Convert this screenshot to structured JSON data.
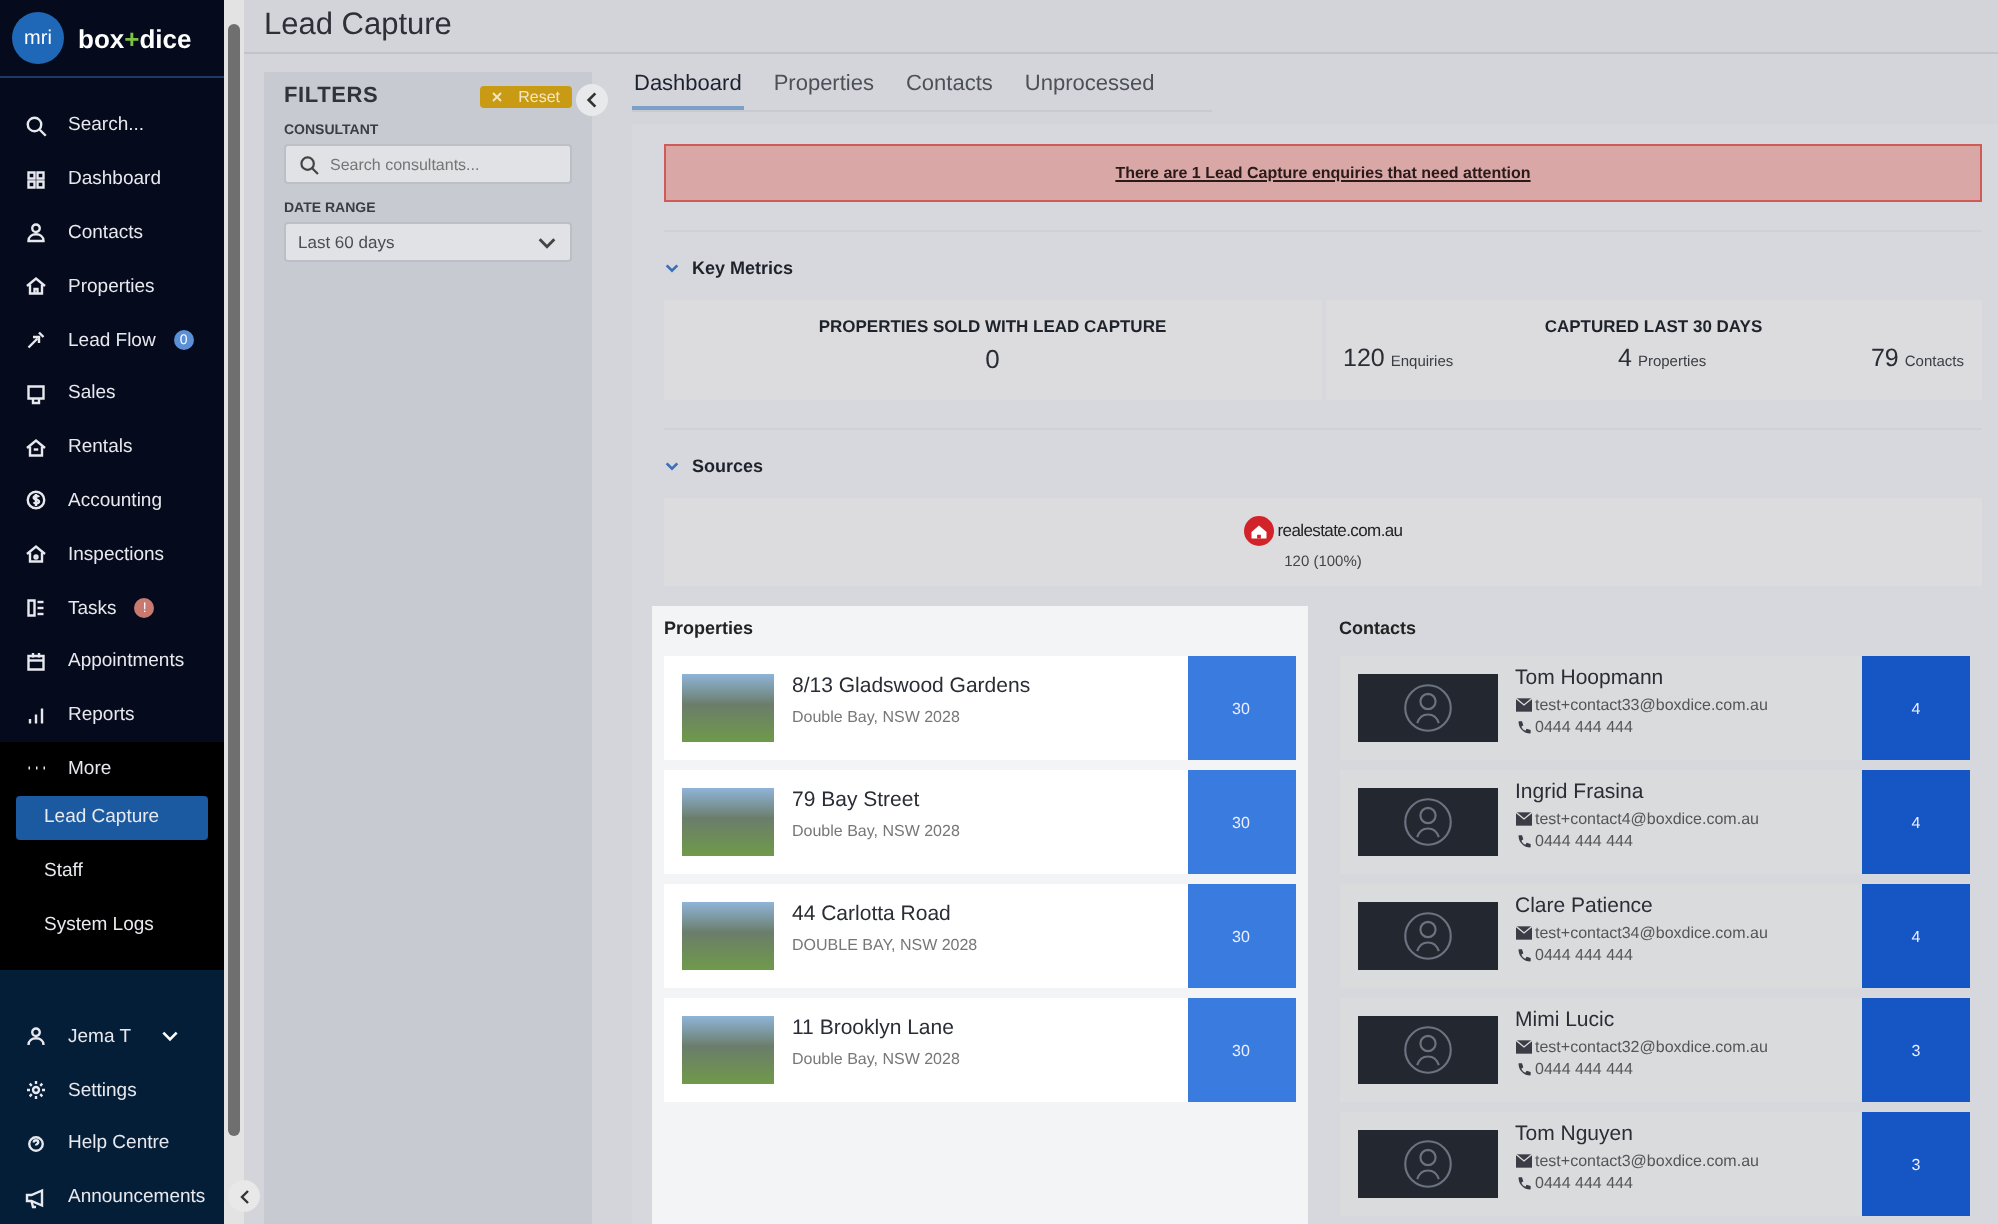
{
  "sidebar": {
    "brand": {
      "badge": "mri",
      "left": "box",
      "mark": "+",
      "right": "dice"
    },
    "nav": [
      {
        "label": "Search..."
      },
      {
        "label": "Dashboard"
      },
      {
        "label": "Contacts"
      },
      {
        "label": "Properties"
      },
      {
        "label": "Lead Flow",
        "badge": {
          "text": "0",
          "color": "#5b8fd6"
        }
      },
      {
        "label": "Sales"
      },
      {
        "label": "Rentals"
      },
      {
        "label": "Accounting"
      },
      {
        "label": "Inspections"
      },
      {
        "label": "Tasks",
        "badge": {
          "text": "!",
          "color": "#c97a70"
        }
      },
      {
        "label": "Appointments"
      },
      {
        "label": "Reports"
      }
    ],
    "more": {
      "label": "More",
      "items": [
        {
          "label": "Lead Capture",
          "selected": true
        },
        {
          "label": "Staff",
          "selected": false
        },
        {
          "label": "System Logs",
          "selected": false
        }
      ]
    },
    "user": {
      "name": "Jema T"
    },
    "bottom": [
      {
        "label": "Settings"
      },
      {
        "label": "Help Centre"
      },
      {
        "label": "Announcements"
      }
    ]
  },
  "page": {
    "title": "Lead Capture"
  },
  "filters": {
    "title": "FILTERS",
    "reset": "Reset",
    "consultant_label": "CONSULTANT",
    "consultant": {
      "placeholder": "Search consultants..."
    },
    "date_label": "DATE RANGE",
    "date_value": "Last 60 days"
  },
  "tabs": [
    {
      "label": "Dashboard",
      "selected": true
    },
    {
      "label": "Properties",
      "selected": false
    },
    {
      "label": "Contacts",
      "selected": false
    },
    {
      "label": "Unprocessed",
      "selected": false
    }
  ],
  "alert": "There are 1 Lead Capture enquiries that need attention",
  "key_metrics": {
    "title": "Key Metrics",
    "expanded": true,
    "cards": [
      {
        "kind": "single",
        "title": "PROPERTIES SOLD WITH LEAD CAPTURE",
        "value": "0"
      },
      {
        "kind": "multi",
        "title": "CAPTURED LAST 30 DAYS",
        "stats": [
          {
            "value": "120",
            "label": "Enquiries"
          },
          {
            "value": "4",
            "label": "Properties"
          },
          {
            "value": "79",
            "label": "Contacts"
          }
        ]
      }
    ]
  },
  "sources": {
    "title": "Sources",
    "expanded": true,
    "items": [
      {
        "name": "realestate.com.au",
        "count": "120 (100%)"
      }
    ]
  },
  "properties": {
    "title": "Properties",
    "highlighted": true,
    "items": [
      {
        "address": "8/13 Gladswood Gardens",
        "suburb": "Double Bay, NSW 2028",
        "count": "30"
      },
      {
        "address": "79 Bay Street",
        "suburb": "Double Bay, NSW 2028",
        "count": "30"
      },
      {
        "address": "44 Carlotta Road",
        "suburb": "DOUBLE BAY, NSW 2028",
        "count": "30"
      },
      {
        "address": "11 Brooklyn Lane",
        "suburb": "Double Bay, NSW 2028",
        "count": "30"
      }
    ]
  },
  "contacts": {
    "title": "Contacts",
    "items": [
      {
        "name": "Tom Hoopmann",
        "email": "test+contact33@boxdice.com.au",
        "phone": "0444 444 444",
        "count": "4"
      },
      {
        "name": "Ingrid Frasina",
        "email": "test+contact4@boxdice.com.au",
        "phone": "0444 444 444",
        "count": "4"
      },
      {
        "name": "Clare Patience",
        "email": "test+contact34@boxdice.com.au",
        "phone": "0444 444 444",
        "count": "4"
      },
      {
        "name": "Mimi Lucic",
        "email": "test+contact32@boxdice.com.au",
        "phone": "0444 444 444",
        "count": "3"
      },
      {
        "name": "Tom Nguyen",
        "email": "test+contact3@boxdice.com.au",
        "phone": "0444 444 444",
        "count": "3"
      }
    ]
  }
}
